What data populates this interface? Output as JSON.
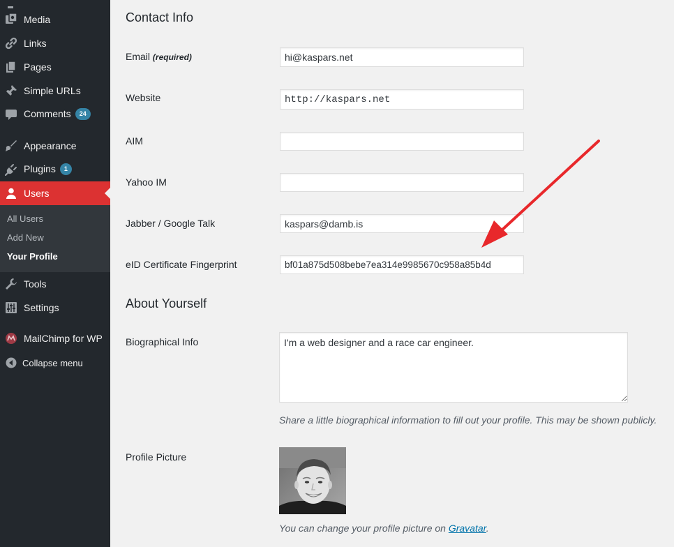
{
  "sidebar": {
    "items": [
      {
        "label": "Media",
        "icon": "media-icon"
      },
      {
        "label": "Links",
        "icon": "link-icon"
      },
      {
        "label": "Pages",
        "icon": "pages-icon"
      },
      {
        "label": "Simple URLs",
        "icon": "pin-icon"
      },
      {
        "label": "Comments",
        "icon": "comment-icon",
        "badge": "24"
      },
      {
        "label": "Appearance",
        "icon": "paintbrush-icon"
      },
      {
        "label": "Plugins",
        "icon": "plugin-icon",
        "badge": "1"
      },
      {
        "label": "Users",
        "icon": "user-icon",
        "current": true
      },
      {
        "label": "Tools",
        "icon": "wrench-icon"
      },
      {
        "label": "Settings",
        "icon": "settings-icon"
      },
      {
        "label": "MailChimp for WP",
        "icon": "mailchimp-icon"
      },
      {
        "label": "Collapse menu",
        "icon": "collapse-icon"
      }
    ],
    "submenu": [
      {
        "label": "All Users"
      },
      {
        "label": "Add New"
      },
      {
        "label": "Your Profile",
        "active": true
      }
    ],
    "colors": {
      "background": "#23282d",
      "current": "#dc3232",
      "badge": "#3584a6"
    }
  },
  "contact_info": {
    "heading": "Contact Info",
    "email": {
      "label": "Email",
      "note": "(required)",
      "value": "hi@kaspars.net"
    },
    "website": {
      "label": "Website",
      "value": "http://kaspars.net"
    },
    "aim": {
      "label": "AIM",
      "value": ""
    },
    "yahoo": {
      "label": "Yahoo IM",
      "value": ""
    },
    "jabber": {
      "label": "Jabber / Google Talk",
      "value": "kaspars@damb.is"
    },
    "eid": {
      "label": "eID Certificate Fingerprint",
      "value": "bf01a875d508bebe7ea314e9985670c958a85b4d"
    }
  },
  "about": {
    "heading": "About Yourself",
    "bio": {
      "label": "Biographical Info",
      "value": "I'm a web designer and a race car engineer.",
      "description": "Share a little biographical information to fill out your profile. This may be shown publicly."
    },
    "picture": {
      "label": "Profile Picture",
      "description_prefix": "You can change your profile picture on ",
      "link_text": "Gravatar",
      "description_suffix": "."
    }
  },
  "annotation": {
    "color": "#e8282b",
    "icon": "arrow-annotation"
  }
}
